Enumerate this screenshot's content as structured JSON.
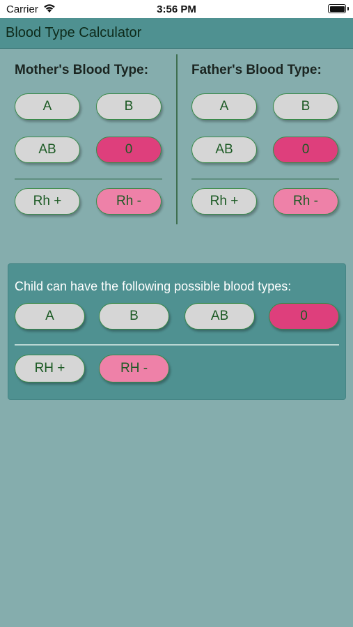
{
  "status_bar": {
    "carrier": "Carrier",
    "time": "3:56 PM"
  },
  "nav": {
    "title": "Blood Type Calculator"
  },
  "mother": {
    "heading": "Mother's Blood Type:",
    "buttons": [
      "A",
      "B",
      "AB",
      "0"
    ],
    "rh": [
      "Rh  +",
      "Rh -"
    ]
  },
  "father": {
    "heading": "Father's Blood Type:",
    "buttons": [
      "A",
      "B",
      "AB",
      "0"
    ],
    "rh": [
      "Rh +",
      "Rh -"
    ]
  },
  "child": {
    "title": "Child can have the following possible blood types:",
    "types": [
      "A",
      "B",
      "AB",
      "0"
    ],
    "rh": [
      "RH +",
      "RH -"
    ]
  },
  "colors": {
    "background": "#85adad",
    "navbar": "#4f9191",
    "button_default": "#d6d6d6",
    "button_selected": "#de3f7c",
    "button_rh_selected": "#ee81a8",
    "button_text": "#1c5a24"
  }
}
